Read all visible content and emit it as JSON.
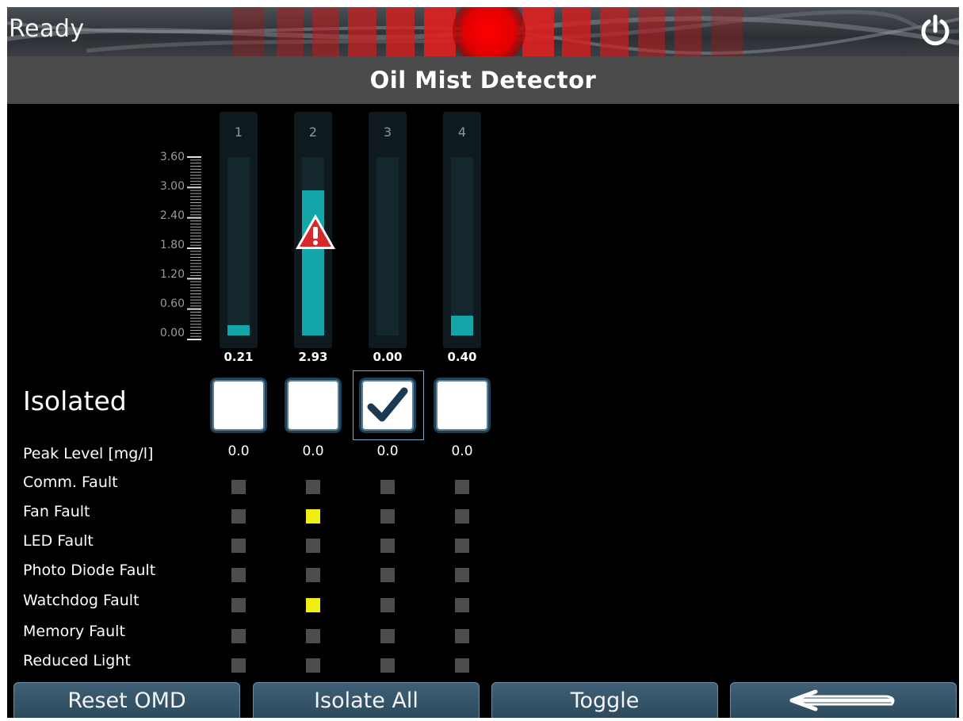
{
  "status": {
    "text": "Ready"
  },
  "page_title": "Oil Mist Detector",
  "scale": {
    "labels": [
      "3.60",
      "3.00",
      "2.40",
      "1.80",
      "1.20",
      "0.60",
      "0.00"
    ],
    "max": 3.6
  },
  "channels": [
    {
      "number": "1",
      "value": "0.21",
      "level": 0.21,
      "isolated": false,
      "alarm": false,
      "peak": "0.0",
      "faults": {
        "comm": false,
        "fan": false,
        "led": false,
        "photo_diode": false,
        "watchdog": false,
        "memory": false,
        "reduced_light": false
      }
    },
    {
      "number": "2",
      "value": "2.93",
      "level": 2.93,
      "isolated": false,
      "alarm": true,
      "peak": "0.0",
      "faults": {
        "comm": false,
        "fan": true,
        "led": false,
        "photo_diode": false,
        "watchdog": true,
        "memory": false,
        "reduced_light": false
      }
    },
    {
      "number": "3",
      "value": "0.00",
      "level": 0.0,
      "isolated": true,
      "alarm": false,
      "peak": "0.0",
      "faults": {
        "comm": false,
        "fan": false,
        "led": false,
        "photo_diode": false,
        "watchdog": false,
        "memory": false,
        "reduced_light": false
      }
    },
    {
      "number": "4",
      "value": "0.40",
      "level": 0.4,
      "isolated": false,
      "alarm": false,
      "peak": "0.0",
      "faults": {
        "comm": false,
        "fan": false,
        "led": false,
        "photo_diode": false,
        "watchdog": false,
        "memory": false,
        "reduced_light": false
      }
    }
  ],
  "rows": {
    "isolated": "Isolated",
    "peak_level": "Peak Level [mg/l]",
    "comm_fault": "Comm. Fault",
    "fan_fault": "Fan Fault",
    "led_fault": "LED Fault",
    "photo_diode_fault": "Photo Diode Fault",
    "watchdog_fault": "Watchdog Fault",
    "memory_fault": "Memory Fault",
    "reduced_light": "Reduced Light"
  },
  "buttons": {
    "reset": "Reset OMD",
    "isolate_all": "Isolate All",
    "toggle": "Toggle",
    "back_icon": "back-arrow-icon"
  },
  "colors": {
    "bar": "#13a5a8",
    "led_on": "#f3ee12",
    "led_off": "#4d4d4d",
    "alarm": "#d7282c"
  },
  "icons": {
    "power": "power-icon",
    "warning": "warning-icon",
    "check": "check-icon"
  }
}
